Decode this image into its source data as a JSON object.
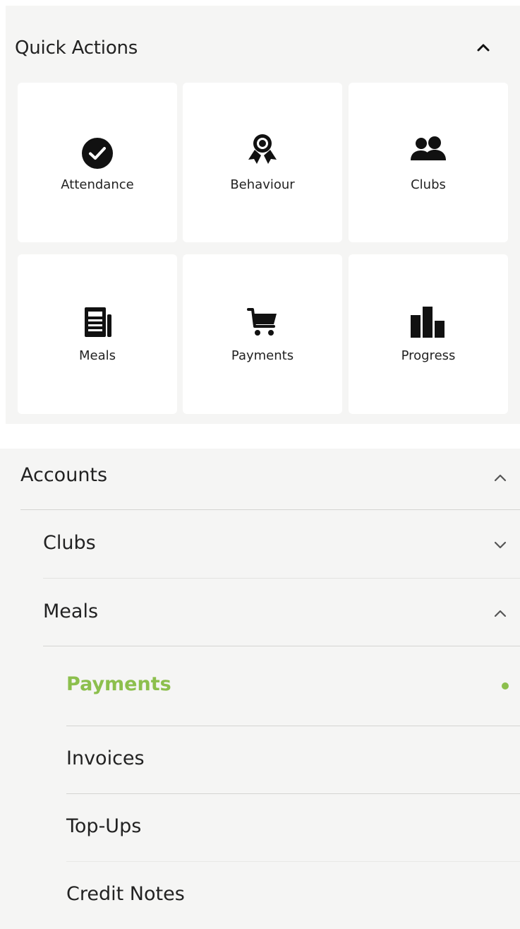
{
  "quick_actions": {
    "title": "Quick Actions",
    "toggle_icon": "chevron-up-icon",
    "tiles": [
      {
        "label": "Attendance",
        "icon": "check-circle-icon"
      },
      {
        "label": "Behaviour",
        "icon": "award-ribbon-icon"
      },
      {
        "label": "Clubs",
        "icon": "users-icon"
      },
      {
        "label": "Meals",
        "icon": "newspaper-icon"
      },
      {
        "label": "Payments",
        "icon": "shopping-cart-icon"
      },
      {
        "label": "Progress",
        "icon": "bar-chart-icon"
      }
    ]
  },
  "accounts": {
    "label": "Accounts",
    "chevron": "chevron-up-icon",
    "items": [
      {
        "label": "Clubs",
        "chevron": "chevron-down-icon"
      },
      {
        "label": "Meals",
        "chevron": "chevron-up-icon"
      }
    ],
    "meals_subitems": [
      {
        "label": "Payments",
        "active": true
      },
      {
        "label": "Invoices"
      },
      {
        "label": "Top-Ups"
      },
      {
        "label": "Credit Notes"
      }
    ]
  },
  "colors": {
    "accent": "#8cbf4d",
    "panel_bg": "#f5f5f4",
    "tile_bg": "#ffffff",
    "text": "#222222",
    "chevron": "#555555"
  }
}
